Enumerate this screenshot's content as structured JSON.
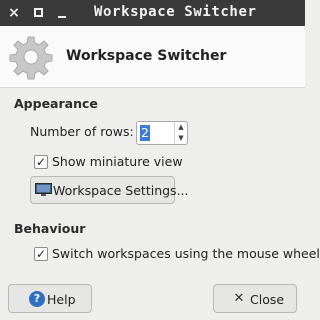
{
  "window": {
    "title": "Workspace Switcher",
    "controls": {
      "close": "×",
      "minimize": "",
      "maximize": ""
    }
  },
  "header": {
    "title": "Workspace Switcher",
    "icon": "gear-icon"
  },
  "appearance": {
    "heading": "Appearance",
    "rows_label": "Number of rows:",
    "rows_value": "2",
    "show_miniature_label": "Show miniature view",
    "show_miniature_checked": true,
    "settings_button_label": "Workspace Settings..."
  },
  "behaviour": {
    "heading": "Behaviour",
    "switch_label": "Switch workspaces using the mouse wheel",
    "switch_checked": true
  },
  "footer": {
    "help_label": "Help",
    "close_label": "Close"
  },
  "colors": {
    "titlebar": "#3a3a3a",
    "selection": "#3d7bd6",
    "help_icon": "#2f6fc3"
  }
}
